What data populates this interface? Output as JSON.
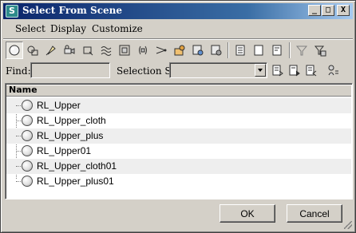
{
  "window": {
    "title": "Select From Scene",
    "app_icon_glyph": "S",
    "controls": {
      "minimize": "_",
      "maximize": "□",
      "close": "X"
    }
  },
  "menu": {
    "items": [
      {
        "label": "Select"
      },
      {
        "label": "Display"
      },
      {
        "label": "Customize"
      }
    ]
  },
  "toolbar": {
    "buttons": [
      {
        "icon": "geometry-filter-icon",
        "active": true
      },
      {
        "icon": "shapes-filter-icon"
      },
      {
        "icon": "lights-filter-icon"
      },
      {
        "icon": "cameras-filter-icon"
      },
      {
        "icon": "helpers-filter-icon"
      },
      {
        "icon": "space-warps-filter-icon"
      },
      {
        "icon": "groups-filter-icon"
      },
      {
        "icon": "xrefs-filter-icon"
      },
      {
        "icon": "bones-filter-icon"
      },
      {
        "icon": "containers-filter-icon"
      },
      {
        "icon": "frozen-filter-icon"
      },
      {
        "icon": "hidden-filter-icon"
      },
      {
        "icon": "display-all-icon"
      },
      {
        "icon": "display-none-icon"
      },
      {
        "icon": "display-invert-icon"
      },
      {
        "icon": "filter-icon"
      },
      {
        "icon": "filter-settings-icon"
      }
    ]
  },
  "find": {
    "label": "Find:",
    "value": "",
    "selection_set_label": "Selection Set:",
    "selection_set_value": "",
    "buttons": [
      {
        "icon": "select-set-icon"
      },
      {
        "icon": "add-to-set-icon"
      },
      {
        "icon": "remove-from-set-icon"
      },
      {
        "icon": "selection-set-options-icon"
      }
    ]
  },
  "list": {
    "column_header": "Name",
    "rows": [
      {
        "name": "RL_Upper"
      },
      {
        "name": "RL_Upper_cloth"
      },
      {
        "name": "RL_Upper_plus"
      },
      {
        "name": "RL_Upper01"
      },
      {
        "name": "RL_Upper_cloth01"
      },
      {
        "name": "RL_Upper_plus01"
      }
    ]
  },
  "footer": {
    "ok_label": "OK",
    "cancel_label": "Cancel"
  }
}
